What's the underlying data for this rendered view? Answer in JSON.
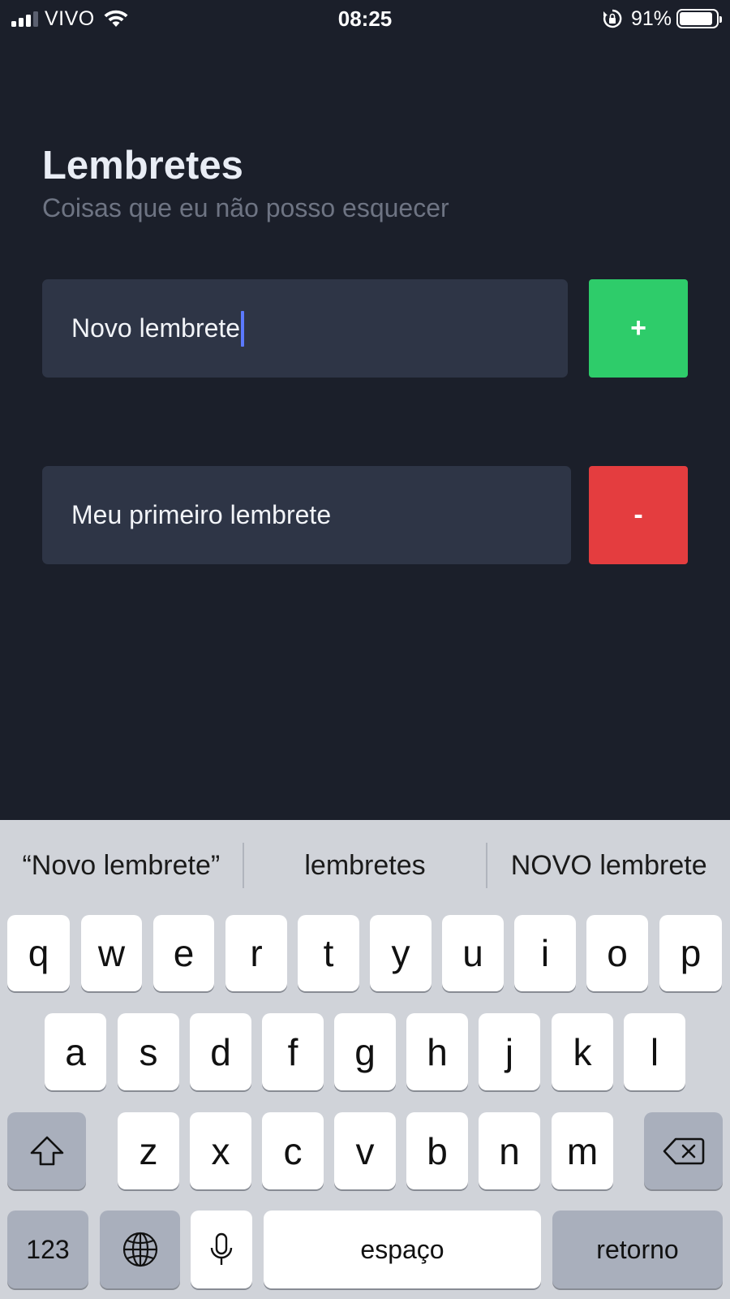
{
  "status_bar": {
    "carrier": "VIVO",
    "time": "08:25",
    "battery": "91%",
    "battery_level": 0.91
  },
  "header": {
    "title": "Lembretes",
    "subtitle": "Coisas que eu não posso esquecer"
  },
  "new_reminder": {
    "value": "Novo lembrete",
    "add_label": "+"
  },
  "reminders": [
    {
      "text": "Meu primeiro lembrete",
      "remove_label": "-"
    }
  ],
  "keyboard": {
    "suggestions": [
      "“Novo lembrete”",
      "lembretes",
      "NOVO lembrete"
    ],
    "row1": [
      "q",
      "w",
      "e",
      "r",
      "t",
      "y",
      "u",
      "i",
      "o",
      "p"
    ],
    "row2": [
      "a",
      "s",
      "d",
      "f",
      "g",
      "h",
      "j",
      "k",
      "l"
    ],
    "row3": [
      "z",
      "x",
      "c",
      "v",
      "b",
      "n",
      "m"
    ],
    "numbers_label": "123",
    "space_label": "espaço",
    "return_label": "retorno"
  },
  "colors": {
    "background": "#1b1f2a",
    "field": "#2e3546",
    "add": "#2ecc6a",
    "remove": "#e43d3f",
    "caret": "#5b79ff"
  }
}
